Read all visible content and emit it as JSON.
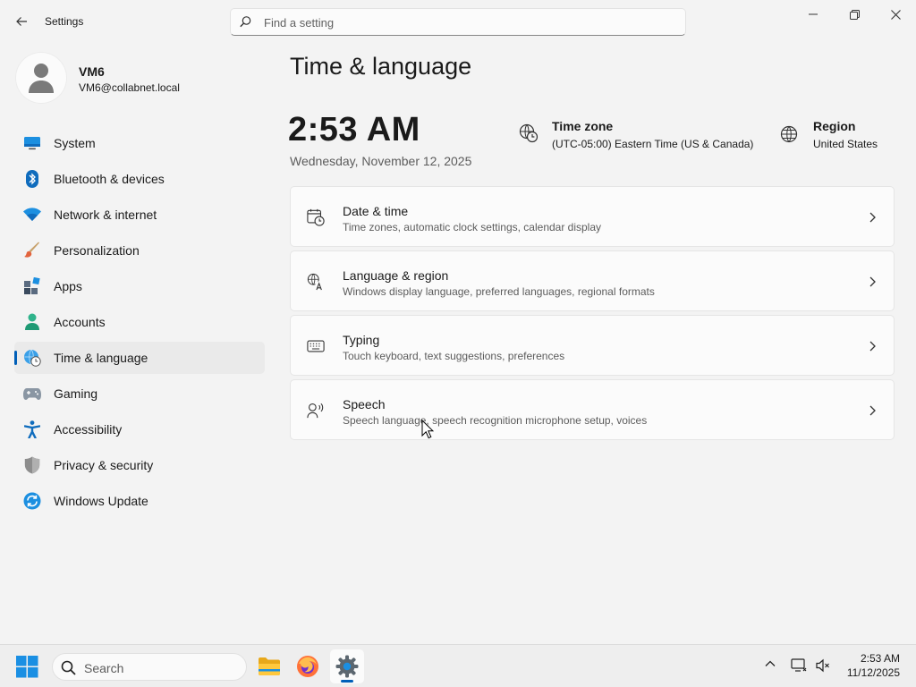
{
  "window": {
    "title": "Settings",
    "search_placeholder": "Find a setting"
  },
  "user": {
    "name": "VM6",
    "email": "VM6@collabnet.local"
  },
  "nav": {
    "items": [
      {
        "label": "System",
        "icon": "monitor-icon"
      },
      {
        "label": "Bluetooth & devices",
        "icon": "bluetooth-icon"
      },
      {
        "label": "Network & internet",
        "icon": "wifi-icon"
      },
      {
        "label": "Personalization",
        "icon": "brush-icon"
      },
      {
        "label": "Apps",
        "icon": "apps-icon"
      },
      {
        "label": "Accounts",
        "icon": "person-icon"
      },
      {
        "label": "Time & language",
        "icon": "globe-clock-icon",
        "active": true
      },
      {
        "label": "Gaming",
        "icon": "gamepad-icon"
      },
      {
        "label": "Accessibility",
        "icon": "accessibility-icon"
      },
      {
        "label": "Privacy & security",
        "icon": "shield-icon"
      },
      {
        "label": "Windows Update",
        "icon": "update-icon"
      }
    ]
  },
  "main": {
    "title": "Time & language",
    "clock": "2:53 AM",
    "date": "Wednesday, November 12, 2025",
    "time_zone": {
      "title": "Time zone",
      "value": "(UTC-05:00) Eastern Time (US & Canada)"
    },
    "region": {
      "title": "Region",
      "value": "United States"
    },
    "cards": [
      {
        "title": "Date & time",
        "desc": "Time zones, automatic clock settings, calendar display",
        "icon": "calendar-clock-icon"
      },
      {
        "title": "Language & region",
        "desc": "Windows display language, preferred languages, regional formats",
        "icon": "language-icon"
      },
      {
        "title": "Typing",
        "desc": "Touch keyboard, text suggestions, preferences",
        "icon": "keyboard-icon"
      },
      {
        "title": "Speech",
        "desc": "Speech language, speech recognition microphone setup, voices",
        "icon": "speech-icon"
      }
    ]
  },
  "taskbar": {
    "search_label": "Search",
    "time": "2:53 AM",
    "date": "11/12/2025"
  },
  "colors": {
    "accent": "#005fb8",
    "background": "#f3f3f3",
    "card": "#fbfbfb"
  }
}
